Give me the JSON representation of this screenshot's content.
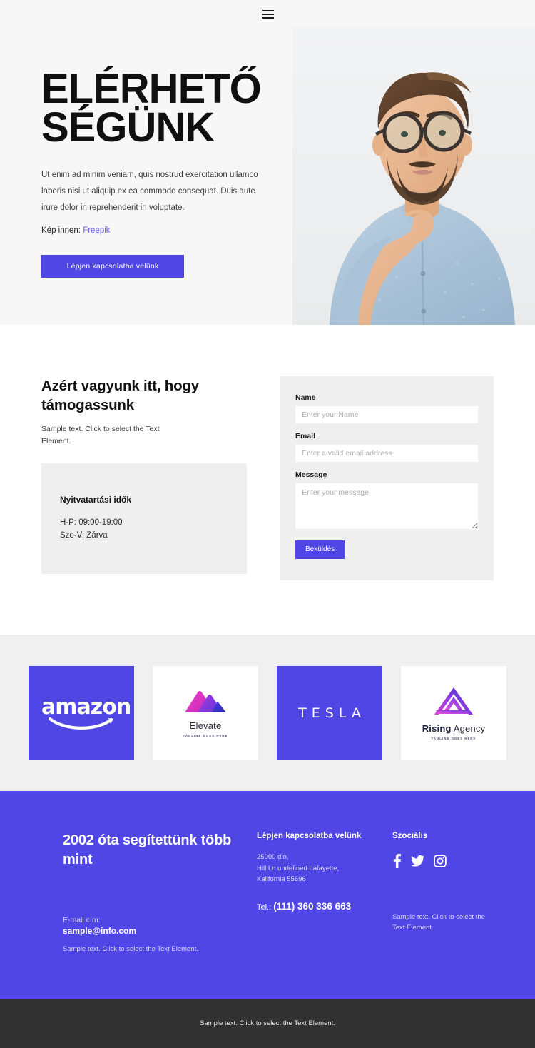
{
  "header": {
    "menu_icon": "hamburger-menu-icon"
  },
  "hero": {
    "title_line1": "ELÉRHETŐ",
    "title_line2": "SÉGÜNK",
    "paragraph": "Ut enim ad minim veniam, quis nostrud exercitation ullamco laboris nisi ut aliquip ex ea commodo consequat. Duis aute irure dolor in reprehenderit in voluptate.",
    "credit_label": "Kép innen:",
    "credit_link": "Freepik",
    "cta_label": "Lépjen kapcsolatba velünk",
    "image_alt": "bearded-man-with-glasses-thinking"
  },
  "contact": {
    "heading": "Azért vagyunk itt, hogy támogassunk",
    "subtext": "Sample text. Click to select the Text Element.",
    "hours": {
      "title": "Nyitvatartási idők",
      "line1": "H-P: 09:00-19:00",
      "line2": "Szo-V: Zárva"
    },
    "form": {
      "name_label": "Name",
      "name_placeholder": "Enter your Name",
      "name_value": "",
      "email_label": "Email",
      "email_placeholder": "Enter a valid email address",
      "email_value": "",
      "message_label": "Message",
      "message_placeholder": "Enter your message",
      "message_value": "",
      "submit_label": "Beküldés"
    }
  },
  "logos": [
    {
      "name": "amazon",
      "wordmark": "amazon",
      "style": "purple"
    },
    {
      "name": "elevate",
      "wordmark": "Elevate",
      "tagline": "TAGLINE GOES HERE",
      "style": "white"
    },
    {
      "name": "tesla",
      "wordmark": "TESLA",
      "style": "purple"
    },
    {
      "name": "rising-agency",
      "wordmark_bold": "Rising",
      "wordmark_light": "Agency",
      "tagline": "TAGLINE GOES HERE",
      "style": "white"
    }
  ],
  "footer": {
    "col1": {
      "heading": "2002 óta segítettünk több mint",
      "email_label": "E-mail cím:",
      "email": "sample@info.com",
      "note": "Sample text. Click to select the Text Element."
    },
    "col2": {
      "heading": "Lépjen kapcsolatba velünk",
      "address_line1": "25000 dió,",
      "address_line2": "Hill Ln undefined Lafayette,",
      "address_line3": "Kalifornia 55696",
      "tel_label": "Tel.:",
      "tel_number": "(111) 360 336 663"
    },
    "col3": {
      "heading": "Szociális",
      "social": [
        "facebook-icon",
        "twitter-icon",
        "instagram-icon"
      ],
      "note": "Sample text. Click to select the Text Element."
    }
  },
  "bottombar": {
    "text": "Sample text. Click to select the Text Element."
  },
  "colors": {
    "accent": "#4f46e5",
    "hero_bg": "#f7f7f7",
    "panel_bg": "#efefef",
    "logos_bg": "#f0f0f0",
    "bottombar_bg": "#313131",
    "link": "#7166e0"
  }
}
